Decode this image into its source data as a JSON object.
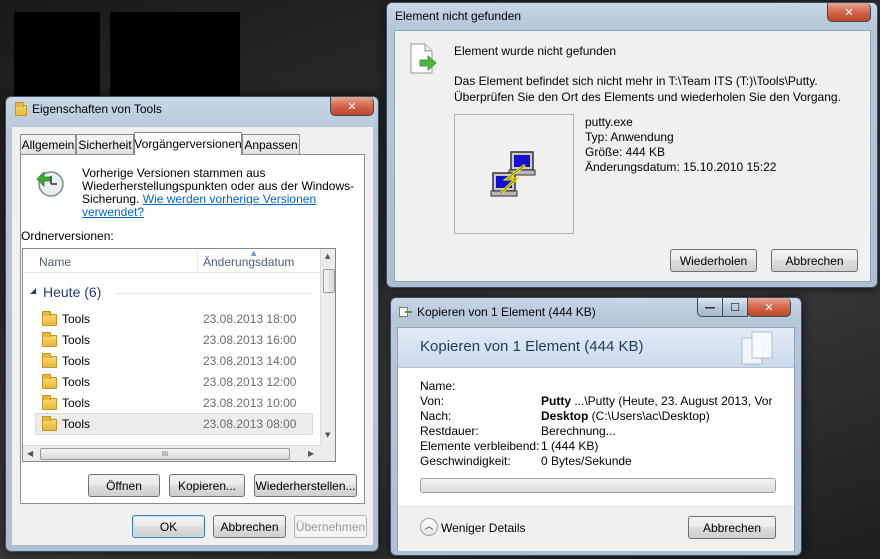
{
  "props_window": {
    "title": "Eigenschaften von Tools",
    "close_label": "✕",
    "tabs": [
      "Allgemein",
      "Sicherheit",
      "Vorgängerversionen",
      "Anpassen"
    ],
    "info_text": [
      "Vorherige Versionen stammen aus",
      "Wiederherstellungspunkten oder aus der Windows-",
      "Sicherung. "
    ],
    "info_link": [
      "Wie werden vorherige Versionen",
      "verwendet?"
    ],
    "versions_label": "Ordnerversionen:",
    "columns": [
      "Name",
      "Änderungsdatum"
    ],
    "group_label": "Heute (6)",
    "rows": [
      {
        "name": "Tools",
        "date": "23.08.2013 18:00"
      },
      {
        "name": "Tools",
        "date": "23.08.2013 16:00"
      },
      {
        "name": "Tools",
        "date": "23.08.2013 14:00"
      },
      {
        "name": "Tools",
        "date": "23.08.2013 12:00"
      },
      {
        "name": "Tools",
        "date": "23.08.2013 10:00"
      },
      {
        "name": "Tools",
        "date": "23.08.2013 08:00"
      }
    ],
    "hscroll_grip": "III",
    "buttons": {
      "open": "Öffnen",
      "copy": "Kopieren...",
      "restore": "Wiederherstellen..."
    },
    "footer_buttons": {
      "ok": "OK",
      "cancel": "Abbrechen",
      "apply": "Übernehmen"
    }
  },
  "notfound_window": {
    "title": "Element nicht gefunden",
    "close_label": "✕",
    "heading": "Element wurde nicht gefunden",
    "message_lines": [
      "Das Element befindet sich nicht mehr in T:\\Team ITS (T:)\\Tools\\Putty.",
      "Überprüfen Sie den Ort des Elements und wiederholen Sie den Vorgang."
    ],
    "file": {
      "name": "putty.exe",
      "type": "Typ: Anwendung",
      "size": "Größe: 444 KB",
      "modified": "Änderungsdatum: 15.10.2010 15:22"
    },
    "buttons": {
      "retry": "Wiederholen",
      "cancel": "Abbrechen"
    }
  },
  "copy_window": {
    "title": "Kopieren von 1 Element (444 KB)",
    "header": "Kopieren von 1 Element (444 KB)",
    "controls": {
      "minimize": "—",
      "maximize": "☐",
      "close": "✕"
    },
    "details": [
      {
        "label": "Name:",
        "bold": "",
        "value": ""
      },
      {
        "label": "Von:",
        "bold": "Putty",
        "value": " ...\\Putty (Heute, 23. August 2013, Vor"
      },
      {
        "label": "Nach:",
        "bold": "Desktop",
        "value": " (C:\\Users\\ac\\Desktop)"
      },
      {
        "label": "Restdauer:",
        "bold": "",
        "value": "Berechnung..."
      },
      {
        "label": "Elemente verbleibend:",
        "bold": "",
        "value": "1 (444 KB)"
      },
      {
        "label": "Geschwindigkeit:",
        "bold": "",
        "value": "0 Bytes/Sekunde"
      }
    ],
    "progress": 0,
    "less_details": "Weniger Details",
    "cancel": "Abbrechen"
  },
  "colors": {
    "accent": "#0066cc",
    "header_bg": "#d8e4f0"
  }
}
